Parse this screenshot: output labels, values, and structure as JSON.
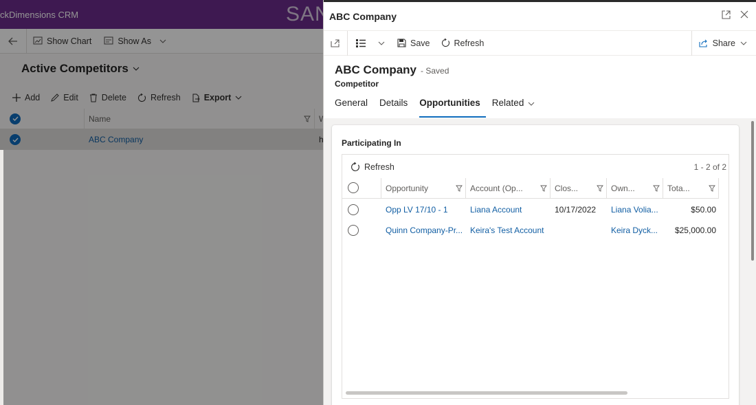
{
  "app": {
    "name": "ckDimensions CRM",
    "env_badge": "SAN",
    "commands": {
      "show_chart": "Show Chart",
      "show_as": "Show As"
    },
    "view_title": "Active Competitors",
    "grid_commands": {
      "add": "Add",
      "edit": "Edit",
      "delete": "Delete",
      "refresh": "Refresh",
      "export": "Export"
    },
    "grid": {
      "columns": [
        "Name",
        "W"
      ],
      "rows": [
        {
          "name": "ABC Company",
          "second_col": "h"
        }
      ]
    }
  },
  "panel": {
    "title": "ABC Company",
    "commands": {
      "save": "Save",
      "refresh": "Refresh",
      "share": "Share"
    },
    "record": {
      "name": "ABC Company",
      "status": "- Saved",
      "entity": "Competitor"
    },
    "tabs": [
      {
        "label": "General"
      },
      {
        "label": "Details"
      },
      {
        "label": "Opportunities"
      },
      {
        "label": "Related"
      }
    ],
    "section_title": "Participating In",
    "subgrid": {
      "refresh_label": "Refresh",
      "count": "1 - 2 of 2",
      "columns": [
        "Opportunity",
        "Account (Op...",
        "Clos...",
        "Own...",
        "Tota..."
      ],
      "rows": [
        {
          "opportunity": "Opp LV 17/10 - 1",
          "account": "Liana Account",
          "close": "10/17/2022",
          "owner": "Liana Volia...",
          "total": "$50.00"
        },
        {
          "opportunity": "Quinn Company-Pr...",
          "account": "Keira's Test Account",
          "close": "",
          "owner": "Keira Dyck...",
          "total": "$25,000.00"
        }
      ]
    }
  },
  "colors": {
    "brand_bar": "#6b2c8c",
    "accent": "#0f6cbd",
    "link": "#115ea3"
  }
}
